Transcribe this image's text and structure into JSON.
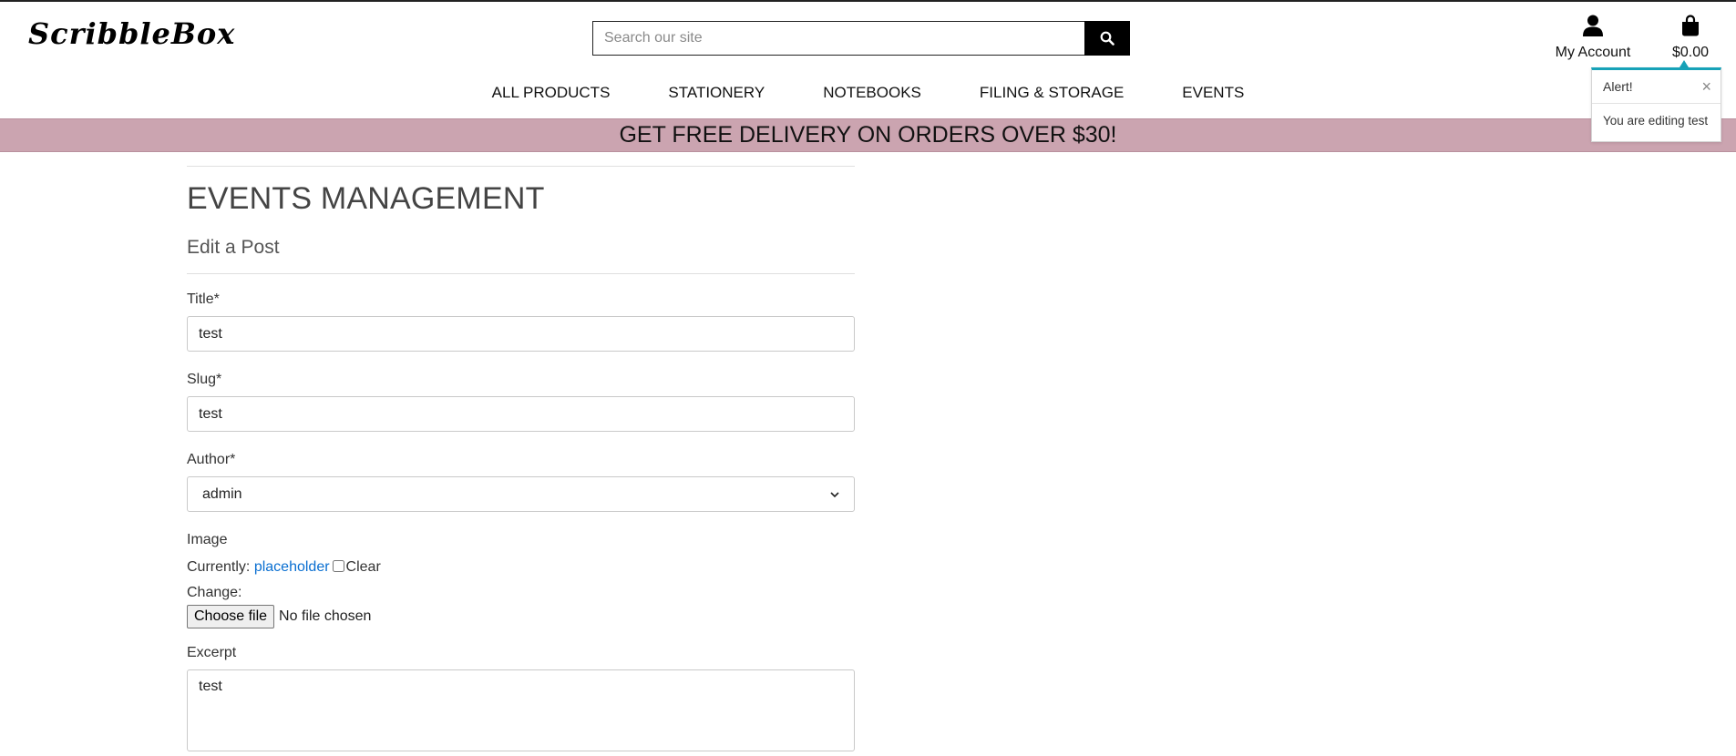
{
  "brand": {
    "logo_text": "ScribbleBox"
  },
  "search": {
    "placeholder": "Search our site",
    "icon": "search-icon"
  },
  "account": {
    "label": "My Account",
    "icon": "user-icon"
  },
  "bag": {
    "total": "$0.00",
    "icon": "shopping-bag-icon"
  },
  "nav": {
    "items": [
      {
        "label": "ALL PRODUCTS"
      },
      {
        "label": "STATIONERY"
      },
      {
        "label": "NOTEBOOKS"
      },
      {
        "label": "FILING & STORAGE"
      },
      {
        "label": "EVENTS"
      }
    ]
  },
  "banner": {
    "text": "GET FREE DELIVERY ON ORDERS OVER $30!",
    "color": "#cba4b0"
  },
  "toast": {
    "title": "Alert!",
    "close_glyph": "×",
    "message": "You are editing test",
    "accent_color": "#17a2b8"
  },
  "page": {
    "heading": "EVENTS MANAGEMENT",
    "subheading": "Edit a Post"
  },
  "form": {
    "title": {
      "label": "Title*",
      "value": "test"
    },
    "slug": {
      "label": "Slug*",
      "value": "test"
    },
    "author": {
      "label": "Author*",
      "selected": "admin"
    },
    "image": {
      "label": "Image",
      "currently_label": "Currently:",
      "current_file": "placeholder",
      "clear_label": "Clear",
      "change_label": "Change:",
      "choose_button": "Choose file",
      "no_file_text": "No file chosen"
    },
    "excerpt": {
      "label": "Excerpt",
      "value": "test"
    }
  }
}
